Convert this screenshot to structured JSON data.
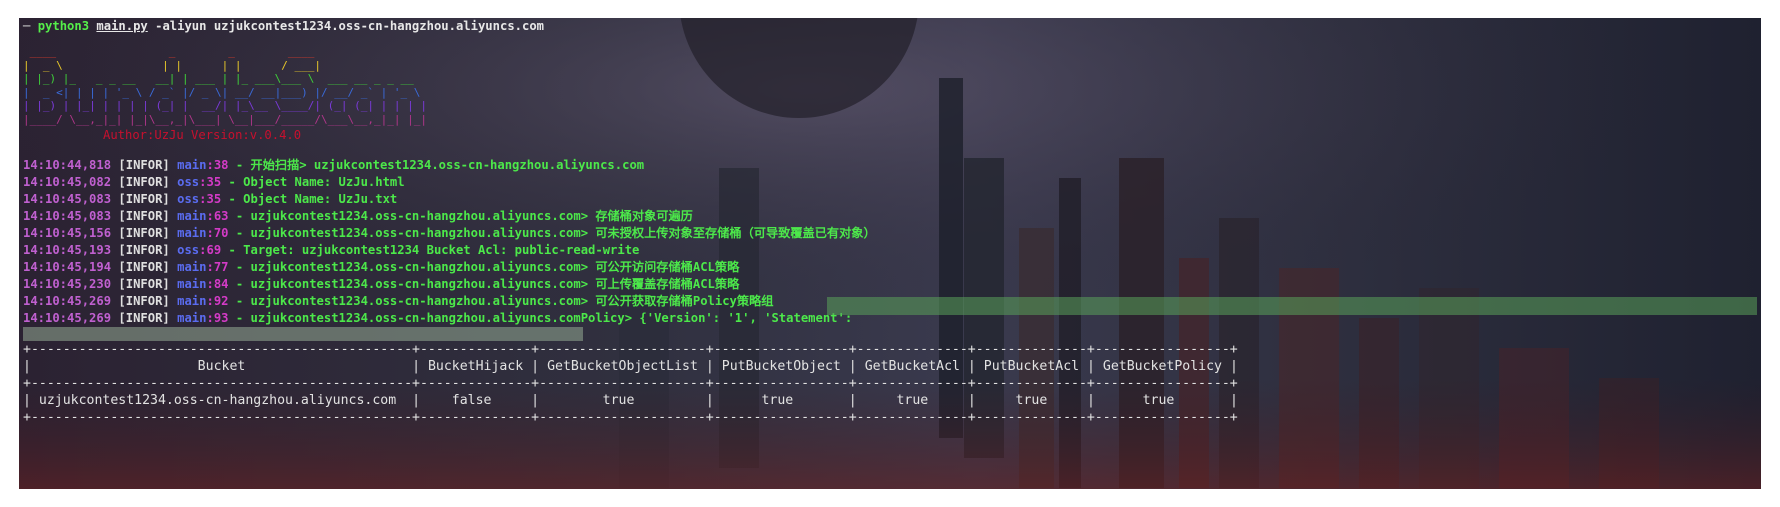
{
  "prompt": {
    "marker": "─",
    "program": "python3",
    "script": "main.py",
    "args": "-aliyun uzjukcontest1234.oss-cn-hangzhou.aliyuncs.com"
  },
  "banner": {
    "ascii_lines": [
      " ____                 _        _        ____",
      "|  _ \\               | |      | |      / ___|",
      "| |_) |_   _ _ __   __| | ___ | |_ ___\\___ \\  ___ __ _ _ __",
      "|  _ <| | | | '_ \\ / _` |/ _ \\| __/ __|___) |/ __/ _` | '_ \\",
      "| |_) | |_| | | | | (_| |  __/| |_\\__ \\____/| (_| (_| | | | |",
      "|____/ \\__,_|_| |_|\\__,_|\\___| \\__|___/_____/\\___\\__,_|_| |_|"
    ],
    "ascii_colors": [
      "#d83b2a",
      "#e8c82a",
      "#3fcf3a",
      "#3a6ad8",
      "#7a3ad8",
      "#b0368a"
    ],
    "author": "Author:UzJu  Version:v.0.4.0"
  },
  "logs": [
    {
      "ts": "14:10:44,818",
      "lvl": "[INFOR]",
      "mod": "main",
      "line": ":38",
      "msg": " - 开始扫描> uzjukcontest1234.oss-cn-hangzhou.aliyuncs.com"
    },
    {
      "ts": "14:10:45,082",
      "lvl": "[INFOR]",
      "mod": "oss",
      "line": ":35",
      "msg": " - Object Name: UzJu.html"
    },
    {
      "ts": "14:10:45,083",
      "lvl": "[INFOR]",
      "mod": "oss",
      "line": ":35",
      "msg": " - Object Name: UzJu.txt"
    },
    {
      "ts": "14:10:45,083",
      "lvl": "[INFOR]",
      "mod": "main",
      "line": ":63",
      "msg": " - uzjukcontest1234.oss-cn-hangzhou.aliyuncs.com> 存储桶对象可遍历"
    },
    {
      "ts": "14:10:45,156",
      "lvl": "[INFOR]",
      "mod": "main",
      "line": ":70",
      "msg": " - uzjukcontest1234.oss-cn-hangzhou.aliyuncs.com> 可未授权上传对象至存储桶（可导致覆盖已有对象）"
    },
    {
      "ts": "14:10:45,193",
      "lvl": "[INFOR]",
      "mod": "oss",
      "line": ":69",
      "msg": " - Target: uzjukcontest1234 Bucket Acl: public-read-write"
    },
    {
      "ts": "14:10:45,194",
      "lvl": "[INFOR]",
      "mod": "main",
      "line": ":77",
      "msg": " - uzjukcontest1234.oss-cn-hangzhou.aliyuncs.com> 可公开访问存储桶ACL策略"
    },
    {
      "ts": "14:10:45,230",
      "lvl": "[INFOR]",
      "mod": "main",
      "line": ":84",
      "msg": " - uzjukcontest1234.oss-cn-hangzhou.aliyuncs.com> 可上传覆盖存储桶ACL策略"
    },
    {
      "ts": "14:10:45,269",
      "lvl": "[INFOR]",
      "mod": "main",
      "line": ":92",
      "msg": " - uzjukcontest1234.oss-cn-hangzhou.aliyuncs.com> 可公开获取存储桶Policy策略组"
    },
    {
      "ts": "14:10:45,269",
      "lvl": "[INFOR]",
      "mod": "main",
      "line": ":93",
      "msg": " - uzjukcontest1234.oss-cn-hangzhou.aliyuncs.comPolicy> {'Version': '1', 'Statement':"
    }
  ],
  "table": {
    "columns": [
      "Bucket",
      "BucketHijack",
      "GetBucketObjectList",
      "PutBucketObject",
      "GetBucketAcl",
      "PutBucketAcl",
      "GetBucketPolicy"
    ],
    "rows": [
      [
        "uzjukcontest1234.oss-cn-hangzhou.aliyuncs.com",
        "false",
        "true",
        "true",
        "true",
        "true",
        "true"
      ]
    ]
  },
  "colors": {
    "timestamp": "#c060d0",
    "level": "#e0e0e0",
    "module": "#5a6cf0",
    "lineno": "#d43bc7",
    "message": "#4ce84a",
    "author": "#c8102e",
    "table": "#e2e2e2"
  }
}
